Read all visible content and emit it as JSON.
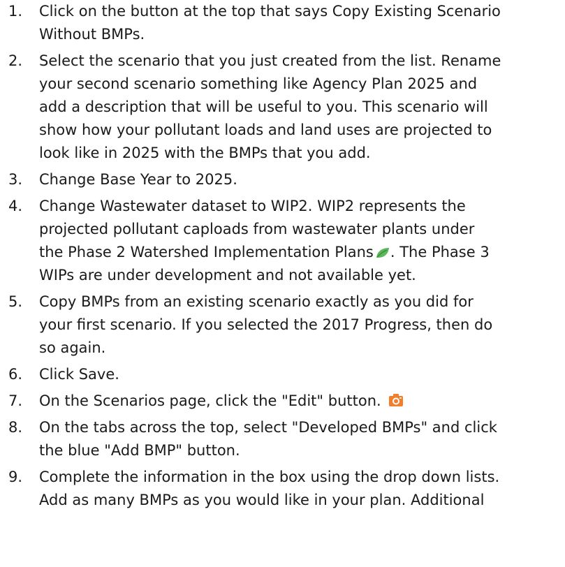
{
  "steps": [
    {
      "num": "1.",
      "lines": [
        "Click on the button at the top that says Copy Existing Scenario",
        "Without BMPs."
      ]
    },
    {
      "num": "2.",
      "lines": [
        "Select the scenario that you just created from the list. Rename",
        "your second scenario something like Agency Plan 2025 and",
        "add a description that will be useful to you. This scenario will",
        "show how your pollutant loads and land uses are projected to",
        "look like in 2025 with the BMPs that you add."
      ]
    },
    {
      "num": "3.",
      "lines": [
        "Change Base Year to 2025."
      ]
    },
    {
      "num": "4.",
      "lines": [
        "Change Wastewater dataset to WIP2. WIP2 represents the",
        "projected pollutant caploads from wastewater plants under",
        "the Phase 2 Watershed Implementation Plans",
        ". The Phase 3",
        "WIPs are under development and not available yet."
      ],
      "icon": "leaf-icon"
    },
    {
      "num": "5.",
      "lines": [
        "Copy BMPs from an existing scenario exactly as you did for",
        "your first scenario. If you selected the 2017 Progress, then do",
        "so again."
      ]
    },
    {
      "num": "6.",
      "lines": [
        "Click Save."
      ]
    },
    {
      "num": "7.",
      "lines": [
        "On the Scenarios page, click the \"Edit\" button."
      ],
      "icon": "camera-icon"
    },
    {
      "num": "8.",
      "lines": [
        "On the tabs across the top, select \"Developed BMPs\" and click",
        "the blue \"Add BMP\" button."
      ]
    },
    {
      "num": "9.",
      "lines": [
        "Complete the information in the box using the drop down lists.",
        "Add as many BMPs as you would like in your plan. Additional"
      ]
    }
  ],
  "icon_colors": {
    "leaf": "#5cb85c",
    "camera": "#f07f2e"
  }
}
